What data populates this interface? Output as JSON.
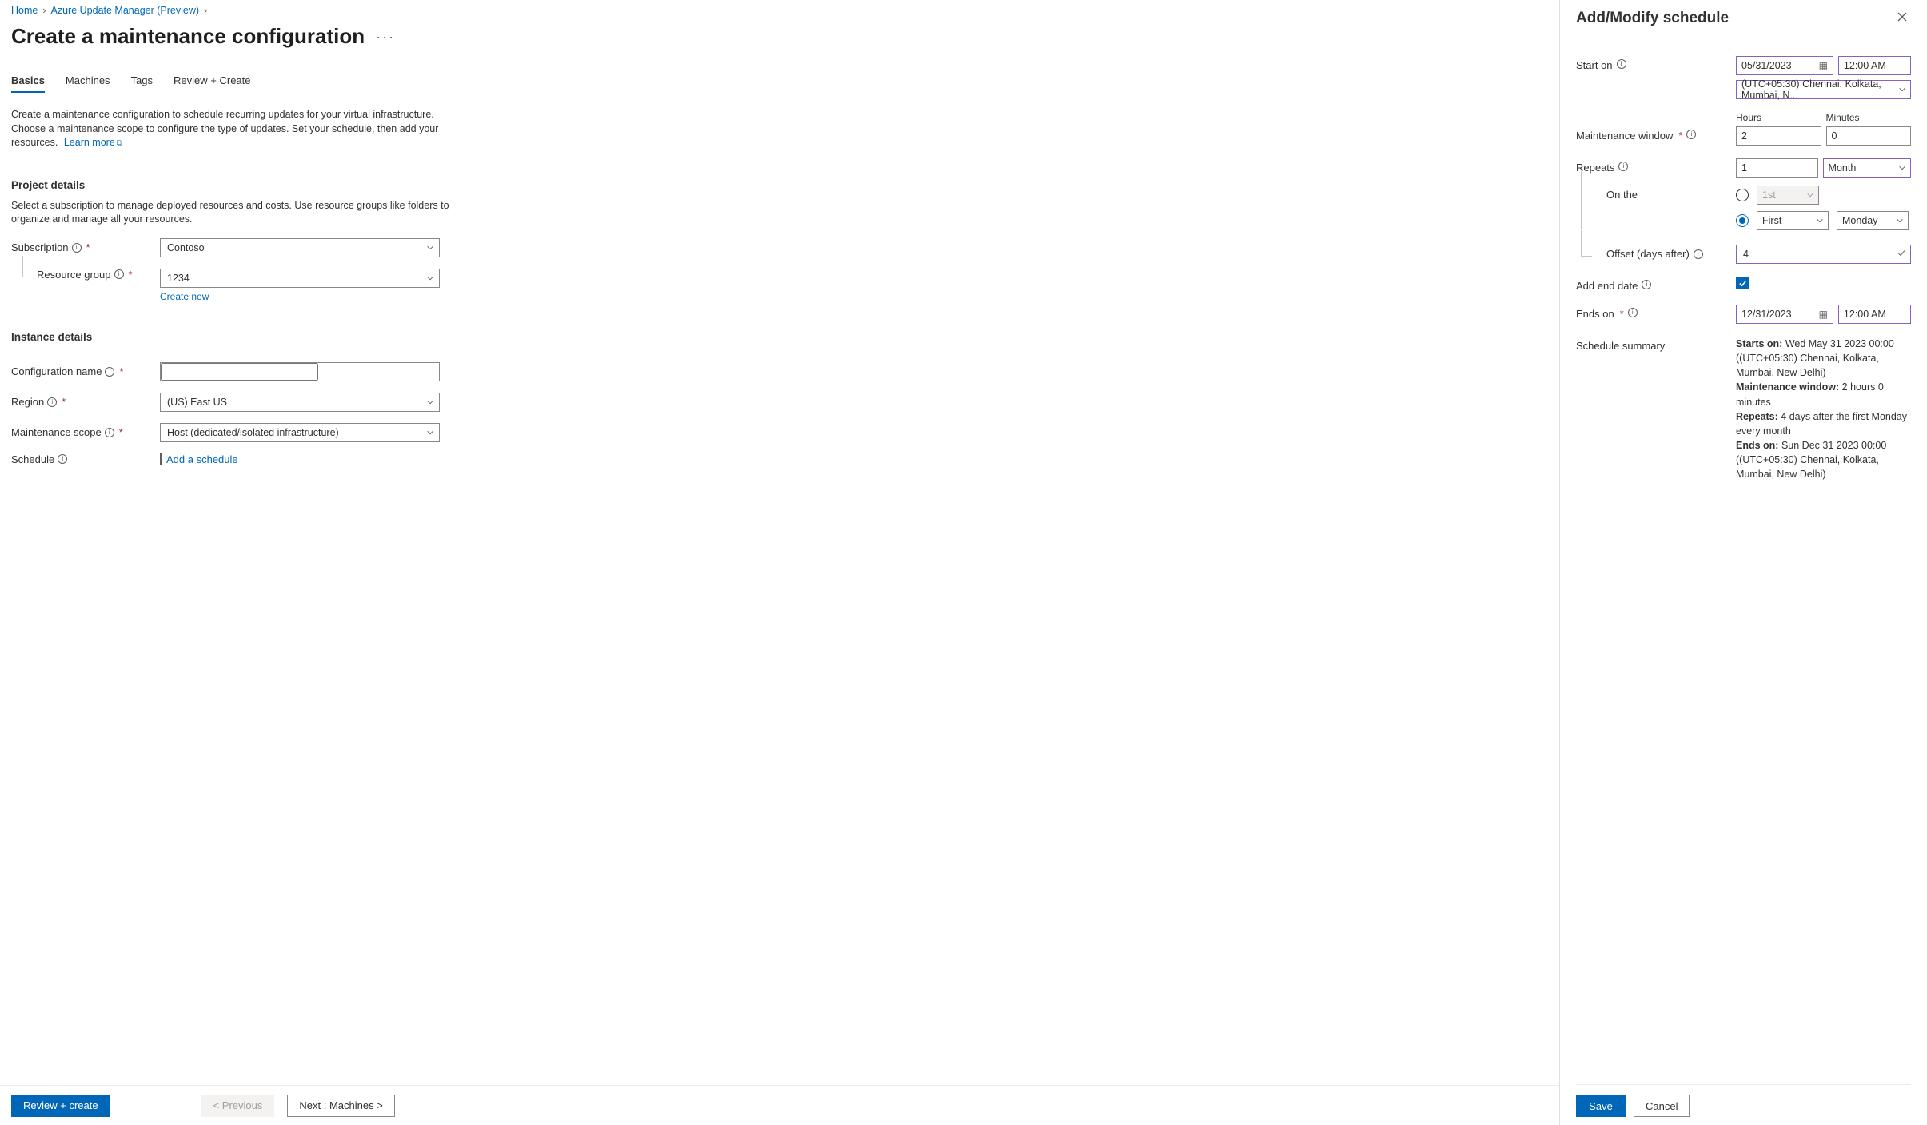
{
  "breadcrumb": {
    "home": "Home",
    "updateManager": "Azure Update Manager (Preview)"
  },
  "pageTitle": "Create a maintenance configuration",
  "tabs": {
    "basics": "Basics",
    "machines": "Machines",
    "tags": "Tags",
    "review": "Review + Create"
  },
  "desc": {
    "text": "Create a maintenance configuration to schedule recurring updates for your virtual infrastructure. Choose a maintenance scope to configure the type of updates. Set your schedule, then add your resources.",
    "learnMore": "Learn more"
  },
  "project": {
    "heading": "Project details",
    "desc": "Select a subscription to manage deployed resources and costs. Use resource groups like folders to organize and manage all your resources.",
    "subscriptionLabel": "Subscription",
    "subscriptionValue": "Contoso",
    "resourceGroupLabel": "Resource group",
    "resourceGroupValue": "1234",
    "createNew": "Create new"
  },
  "instance": {
    "heading": "Instance details",
    "configNameLabel": "Configuration name",
    "configNameValue": "",
    "regionLabel": "Region",
    "regionValue": "(US) East US",
    "scopeLabel": "Maintenance scope",
    "scopeValue": "Host (dedicated/isolated infrastructure)",
    "scheduleLabel": "Schedule",
    "addSchedule": "Add a schedule"
  },
  "footer": {
    "review": "Review + create",
    "previous": "< Previous",
    "next": "Next : Machines >"
  },
  "panel": {
    "title": "Add/Modify schedule",
    "startOnLabel": "Start on",
    "startDate": "05/31/2023",
    "startTime": "12:00 AM",
    "timezone": "(UTC+05:30) Chennai, Kolkata, Mumbai, N...",
    "mwLabel": "Maintenance window",
    "hoursLabel": "Hours",
    "hoursValue": "2",
    "minutesLabel": "Minutes",
    "minutesValue": "0",
    "repeatsLabel": "Repeats",
    "repeatsValue": "1",
    "repeatsUnit": "Month",
    "onTheLabel": "On the",
    "dayNum": "1st",
    "ordinal": "First",
    "weekday": "Monday",
    "offsetLabel": "Offset (days after)",
    "offsetValue": "4",
    "addEndDateLabel": "Add end date",
    "endsOnLabel": "Ends on",
    "endDate": "12/31/2023",
    "endTime": "12:00 AM",
    "summaryLabel": "Schedule summary",
    "summary": {
      "startsOnLabel": "Starts on:",
      "startsOnValue": "Wed May 31 2023 00:00 ((UTC+05:30) Chennai, Kolkata, Mumbai, New Delhi)",
      "mwLabel": "Maintenance window:",
      "mwValue": "2 hours 0 minutes",
      "repeatsLabel": "Repeats:",
      "repeatsValue": "4 days after the first Monday every month",
      "endsOnLabel": "Ends on:",
      "endsOnValue": "Sun Dec 31 2023 00:00 ((UTC+05:30) Chennai, Kolkata, Mumbai, New Delhi)"
    },
    "save": "Save",
    "cancel": "Cancel"
  }
}
